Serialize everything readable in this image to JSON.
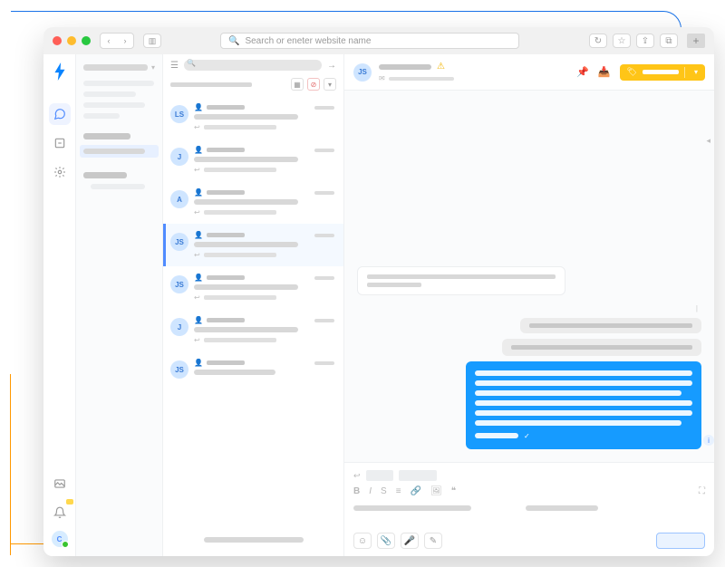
{
  "browser": {
    "search_placeholder": "Search or eneter website name"
  },
  "iconbar": {
    "items": [
      "chat-icon",
      "inbox-icon",
      "settings-icon"
    ],
    "bottom": [
      "screenshot-icon",
      "bell-icon"
    ],
    "avatar_initial": "C"
  },
  "threads": [
    {
      "avatar": "LS",
      "selected": false
    },
    {
      "avatar": "J",
      "selected": false
    },
    {
      "avatar": "A",
      "selected": false
    },
    {
      "avatar": "JS",
      "selected": true
    },
    {
      "avatar": "JS",
      "selected": false
    },
    {
      "avatar": "J",
      "selected": false
    },
    {
      "avatar": "JS",
      "selected": false
    }
  ],
  "conversation": {
    "avatar": "JS",
    "action_label": "",
    "messages": {
      "incoming": {
        "lines": 2
      },
      "outgoing_gray": 2,
      "outgoing_blue_lines": 6
    }
  },
  "colors": {
    "accent": "#169bff",
    "warn": "#ffc517",
    "green": "#3ac430"
  }
}
